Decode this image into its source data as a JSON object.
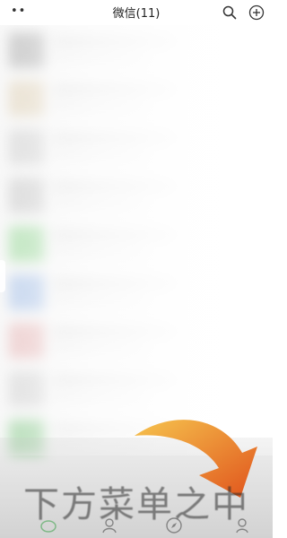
{
  "header": {
    "more_label": "••",
    "title": "微信(11)"
  },
  "icons": {
    "search": "search-icon",
    "add": "add-circle-icon",
    "arrow": "curved-arrow-icon"
  },
  "caption": {
    "text": "下方菜单之中"
  },
  "colors": {
    "arrow_start": "#f6c44e",
    "arrow_end": "#e0531c",
    "caption": "#333333"
  },
  "tabbar": {
    "tabs": [
      "chats-tab-icon",
      "contacts-tab-icon",
      "discover-tab-icon",
      "me-tab-icon"
    ]
  }
}
